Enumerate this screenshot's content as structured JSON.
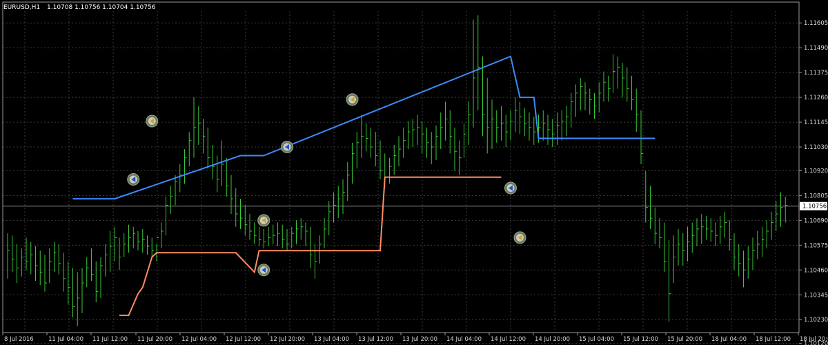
{
  "header": {
    "symbol": "EURUSD,H1",
    "ohlc": "1.10708 1.10756 1.10704 1.10756"
  },
  "colors": {
    "background": "#000000",
    "grid": "#3d3d3d",
    "bar": "#37c837",
    "upper_line": "#3c8cff",
    "lower_line": "#ff8c64",
    "current_price_line": "#8c8c8c",
    "badge_fill": "#ffffff"
  },
  "chart_data": {
    "type": "ohlc",
    "timeframe": "H1",
    "grid": true,
    "ylim": [
      1.1017,
      1.1166
    ],
    "y_ticks": [
      "1.11605",
      "1.11490",
      "1.11375",
      "1.11260",
      "1.11145",
      "1.11030",
      "1.10920",
      "1.10805",
      "1.10690",
      "1.10575",
      "1.10460",
      "1.10345",
      "1.10230",
      "1.10120"
    ],
    "x_ticks": [
      "8 Jul 2016",
      "11 Jul 04:00",
      "11 Jul 12:00",
      "11 Jul 20:00",
      "12 Jul 04:00",
      "12 Jul 12:00",
      "12 Jul 20:00",
      "13 Jul 04:00",
      "13 Jul 12:00",
      "13 Jul 20:00",
      "14 Jul 04:00",
      "14 Jul 12:00",
      "14 Jul 20:00",
      "15 Jul 04:00",
      "15 Jul 12:00",
      "15 Jul 20:00",
      "18 Jul 04:00",
      "18 Jul 12:00",
      "18 Jul 20:00"
    ],
    "current_price": "1.10756",
    "bars_high_low_close": [
      [
        1.1063,
        1.1042,
        1.1055
      ],
      [
        1.1062,
        1.1045,
        1.1051
      ],
      [
        1.1058,
        1.104,
        1.1047
      ],
      [
        1.1056,
        1.1043,
        1.1052
      ],
      [
        1.1061,
        1.1046,
        1.105
      ],
      [
        1.1059,
        1.1044,
        1.1053
      ],
      [
        1.1057,
        1.1041,
        1.1048
      ],
      [
        1.1055,
        1.1039,
        1.1045
      ],
      [
        1.1053,
        1.1036,
        1.104
      ],
      [
        1.1056,
        1.104,
        1.105
      ],
      [
        1.1059,
        1.1045,
        1.1054
      ],
      [
        1.1058,
        1.1044,
        1.1049
      ],
      [
        1.1054,
        1.1036,
        1.1042
      ],
      [
        1.105,
        1.103,
        1.1038
      ],
      [
        1.1047,
        1.1024,
        1.1029
      ],
      [
        1.1045,
        1.102,
        1.1033
      ],
      [
        1.1047,
        1.1026,
        1.104
      ],
      [
        1.1052,
        1.1038,
        1.1047
      ],
      [
        1.1056,
        1.1041,
        1.1044
      ],
      [
        1.105,
        1.1031,
        1.1036
      ],
      [
        1.1052,
        1.1033,
        1.1048
      ],
      [
        1.1058,
        1.1043,
        1.1053
      ],
      [
        1.1064,
        1.1045,
        1.1057
      ],
      [
        1.1066,
        1.105,
        1.1061
      ],
      [
        1.1061,
        1.1046,
        1.1052
      ],
      [
        1.1063,
        1.1052,
        1.1058
      ],
      [
        1.1067,
        1.1054,
        1.1061
      ],
      [
        1.1066,
        1.1056,
        1.1063
      ],
      [
        1.1064,
        1.1055,
        1.1059
      ],
      [
        1.1065,
        1.1054,
        1.106
      ],
      [
        1.1062,
        1.1053,
        1.1057
      ],
      [
        1.1061,
        1.1051,
        1.1055
      ],
      [
        1.1058,
        1.105,
        1.1061
      ],
      [
        1.1068,
        1.1056,
        1.1064
      ],
      [
        1.108,
        1.1062,
        1.1076
      ],
      [
        1.1085,
        1.1072,
        1.108
      ],
      [
        1.109,
        1.1076,
        1.1087
      ],
      [
        1.1095,
        1.1082,
        1.109
      ],
      [
        1.1102,
        1.1086,
        1.1098
      ],
      [
        1.111,
        1.1094,
        1.1106
      ],
      [
        1.1126,
        1.1098,
        1.1112
      ],
      [
        1.1122,
        1.1104,
        1.1114
      ],
      [
        1.1116,
        1.11,
        1.1108
      ],
      [
        1.1112,
        1.1093,
        1.1098
      ],
      [
        1.1104,
        1.1088,
        1.1094
      ],
      [
        1.1099,
        1.1082,
        1.1088
      ],
      [
        1.1106,
        1.1085,
        1.1095
      ],
      [
        1.1098,
        1.108,
        1.1085
      ],
      [
        1.109,
        1.1072,
        1.1079
      ],
      [
        1.1084,
        1.1066,
        1.1072
      ],
      [
        1.1079,
        1.1065,
        1.107
      ],
      [
        1.1076,
        1.1062,
        1.1067
      ],
      [
        1.1072,
        1.106,
        1.1064
      ],
      [
        1.1068,
        1.1058,
        1.1062
      ],
      [
        1.1066,
        1.1057,
        1.106
      ],
      [
        1.1065,
        1.1056,
        1.1059
      ],
      [
        1.1066,
        1.1057,
        1.1061
      ],
      [
        1.1067,
        1.1058,
        1.1062
      ],
      [
        1.1068,
        1.1057,
        1.1063
      ],
      [
        1.1067,
        1.1056,
        1.106
      ],
      [
        1.1065,
        1.1055,
        1.1058
      ],
      [
        1.1066,
        1.1056,
        1.1063
      ],
      [
        1.1069,
        1.1058,
        1.1065
      ],
      [
        1.107,
        1.106,
        1.1066
      ],
      [
        1.1068,
        1.1057,
        1.1064
      ],
      [
        1.1066,
        1.1047,
        1.1053
      ],
      [
        1.1058,
        1.1042,
        1.105
      ],
      [
        1.1062,
        1.1049,
        1.1058
      ],
      [
        1.107,
        1.1056,
        1.1065
      ],
      [
        1.1078,
        1.1062,
        1.1073
      ],
      [
        1.1082,
        1.1068,
        1.1076
      ],
      [
        1.1085,
        1.107,
        1.1079
      ],
      [
        1.1088,
        1.1072,
        1.1082
      ],
      [
        1.1096,
        1.1078,
        1.109
      ],
      [
        1.1105,
        1.1086,
        1.11
      ],
      [
        1.111,
        1.1093,
        1.1105
      ],
      [
        1.1118,
        1.1098,
        1.1108
      ],
      [
        1.1114,
        1.1101,
        1.1107
      ],
      [
        1.1112,
        1.1098,
        1.1103
      ],
      [
        1.111,
        1.1094,
        1.1099
      ],
      [
        1.1106,
        1.1088,
        1.1092
      ],
      [
        1.11,
        1.1084,
        1.1089
      ],
      [
        1.1098,
        1.1086,
        1.1094
      ],
      [
        1.1104,
        1.109,
        1.1099
      ],
      [
        1.1108,
        1.1094,
        1.1102
      ],
      [
        1.1112,
        1.1098,
        1.1106
      ],
      [
        1.1115,
        1.1102,
        1.111
      ],
      [
        1.1116,
        1.1103,
        1.1111
      ],
      [
        1.1118,
        1.1104,
        1.1112
      ],
      [
        1.1115,
        1.11,
        1.1109
      ],
      [
        1.1112,
        1.1098,
        1.1105
      ],
      [
        1.111,
        1.1095,
        1.1103
      ],
      [
        1.1113,
        1.1097,
        1.1108
      ],
      [
        1.1119,
        1.1102,
        1.1112
      ],
      [
        1.1124,
        1.1106,
        1.1116
      ],
      [
        1.112,
        1.11,
        1.1108
      ],
      [
        1.1112,
        1.1092,
        1.1101
      ],
      [
        1.1106,
        1.109,
        1.1098
      ],
      [
        1.1114,
        1.1098,
        1.1109
      ],
      [
        1.1124,
        1.1104,
        1.1118
      ],
      [
        1.1162,
        1.1112,
        1.1135
      ],
      [
        1.1164,
        1.112,
        1.114
      ],
      [
        1.1145,
        1.1108,
        1.1118
      ],
      [
        1.1135,
        1.11,
        1.1112
      ],
      [
        1.1125,
        1.1102,
        1.1116
      ],
      [
        1.112,
        1.1105,
        1.1112
      ],
      [
        1.1122,
        1.1106,
        1.1114
      ],
      [
        1.1118,
        1.1103,
        1.111
      ],
      [
        1.112,
        1.1106,
        1.1115
      ],
      [
        1.1126,
        1.111,
        1.112
      ],
      [
        1.1124,
        1.1109,
        1.1117
      ],
      [
        1.1121,
        1.1108,
        1.1114
      ],
      [
        1.1119,
        1.1106,
        1.1112
      ],
      [
        1.1117,
        1.1104,
        1.111
      ],
      [
        1.1118,
        1.1105,
        1.1112
      ],
      [
        1.112,
        1.1106,
        1.1114
      ],
      [
        1.1118,
        1.1104,
        1.1111
      ],
      [
        1.1116,
        1.1103,
        1.1109
      ],
      [
        1.1119,
        1.1104,
        1.1113
      ],
      [
        1.112,
        1.1106,
        1.1115
      ],
      [
        1.1122,
        1.1108,
        1.1117
      ],
      [
        1.1128,
        1.1112,
        1.1124
      ],
      [
        1.1132,
        1.1117,
        1.1128
      ],
      [
        1.1135,
        1.112,
        1.1131
      ],
      [
        1.1133,
        1.112,
        1.1128
      ],
      [
        1.113,
        1.1118,
        1.1125
      ],
      [
        1.1128,
        1.1116,
        1.1122
      ],
      [
        1.1133,
        1.1119,
        1.1128
      ],
      [
        1.1138,
        1.1124,
        1.1133
      ],
      [
        1.1136,
        1.1124,
        1.113
      ],
      [
        1.1146,
        1.1128,
        1.1138
      ],
      [
        1.1145,
        1.113,
        1.114
      ],
      [
        1.1142,
        1.1126,
        1.1135
      ],
      [
        1.114,
        1.1124,
        1.113
      ],
      [
        1.1136,
        1.112,
        1.1125
      ],
      [
        1.113,
        1.111,
        1.1118
      ],
      [
        1.112,
        1.1095,
        1.11
      ],
      [
        1.1092,
        1.1068,
        1.1075
      ],
      [
        1.1085,
        1.1065,
        1.107
      ],
      [
        1.1075,
        1.1058,
        1.1063
      ],
      [
        1.107,
        1.1056,
        1.1061
      ],
      [
        1.1068,
        1.1045,
        1.105
      ],
      [
        1.106,
        1.1022,
        1.1035
      ],
      [
        1.1062,
        1.104,
        1.1052
      ],
      [
        1.1065,
        1.1048,
        1.1058
      ],
      [
        1.1063,
        1.1048,
        1.1055
      ],
      [
        1.1066,
        1.105,
        1.1059
      ],
      [
        1.1068,
        1.1054,
        1.1062
      ],
      [
        1.107,
        1.1057,
        1.1065
      ],
      [
        1.1072,
        1.1058,
        1.1066
      ],
      [
        1.1071,
        1.106,
        1.1065
      ],
      [
        1.107,
        1.1059,
        1.1064
      ],
      [
        1.1068,
        1.1057,
        1.1062
      ],
      [
        1.1071,
        1.1058,
        1.1066
      ],
      [
        1.1073,
        1.1061,
        1.1068
      ],
      [
        1.1069,
        1.1055,
        1.106
      ],
      [
        1.1063,
        1.1046,
        1.1052
      ],
      [
        1.1058,
        1.1043,
        1.1049
      ],
      [
        1.1055,
        1.1038,
        1.1046
      ],
      [
        1.1057,
        1.1042,
        1.1051
      ],
      [
        1.1061,
        1.1046,
        1.1055
      ],
      [
        1.1064,
        1.1051,
        1.1058
      ],
      [
        1.1066,
        1.1052,
        1.106
      ],
      [
        1.1069,
        1.1056,
        1.1064
      ],
      [
        1.1073,
        1.106,
        1.1068
      ],
      [
        1.1078,
        1.1064,
        1.1072
      ],
      [
        1.1082,
        1.1066,
        1.1075
      ],
      [
        1.108,
        1.1068,
        1.1076
      ]
    ],
    "series": [
      {
        "color": "blue",
        "points": [
          [
            "8 Jul 2016 19:00",
            1.1079
          ],
          [
            "11 Jul 23:00",
            1.1079
          ],
          [
            "13 Jul 02:00",
            1.1099
          ],
          [
            "13 Jul 07:00",
            1.1099
          ],
          [
            "15 Jul 12:00",
            1.1145
          ],
          [
            "15 Jul 14:00",
            1.1126
          ],
          [
            "15 Jul 17:00",
            1.1126
          ],
          [
            "15 Jul 18:00",
            1.1107
          ],
          [
            "18 Jul 22:00",
            1.1107
          ]
        ]
      },
      {
        "color": "orange",
        "points": [
          [
            "12 Jul 00:00",
            1.1025
          ],
          [
            "12 Jul 02:00",
            1.1025
          ],
          [
            "12 Jul 04:00",
            1.1035
          ],
          [
            "12 Jul 05:00",
            1.1038
          ],
          [
            "12 Jul 07:00",
            1.1052
          ],
          [
            "12 Jul 08:00",
            1.1054
          ],
          [
            "13 Jul 01:00",
            1.1054
          ],
          [
            "13 Jul 05:00",
            1.1045
          ],
          [
            "13 Jul 06:00",
            1.1055
          ],
          [
            "14 Jul 08:00",
            1.1055
          ],
          [
            "14 Jul 09:00",
            1.1089
          ],
          [
            "15 Jul 10:00",
            1.1089
          ]
        ]
      }
    ],
    "signals": [
      {
        "kind": "buy",
        "time": "12 Jul 03:00",
        "price": 1.1088
      },
      {
        "kind": "sell",
        "time": "12 Jul 07:00",
        "price": 1.1115
      },
      {
        "kind": "sell",
        "time": "13 Jul 07:00",
        "price": 1.1069
      },
      {
        "kind": "buy",
        "time": "13 Jul 07:00",
        "price": 1.1046
      },
      {
        "kind": "buy",
        "time": "13 Jul 12:00",
        "price": 1.1103
      },
      {
        "kind": "sell",
        "time": "14 Jul 02:00",
        "price": 1.1125
      },
      {
        "kind": "buy",
        "time": "15 Jul 12:00",
        "price": 1.1084
      },
      {
        "kind": "sell",
        "time": "15 Jul 14:00",
        "price": 1.1061
      }
    ]
  }
}
